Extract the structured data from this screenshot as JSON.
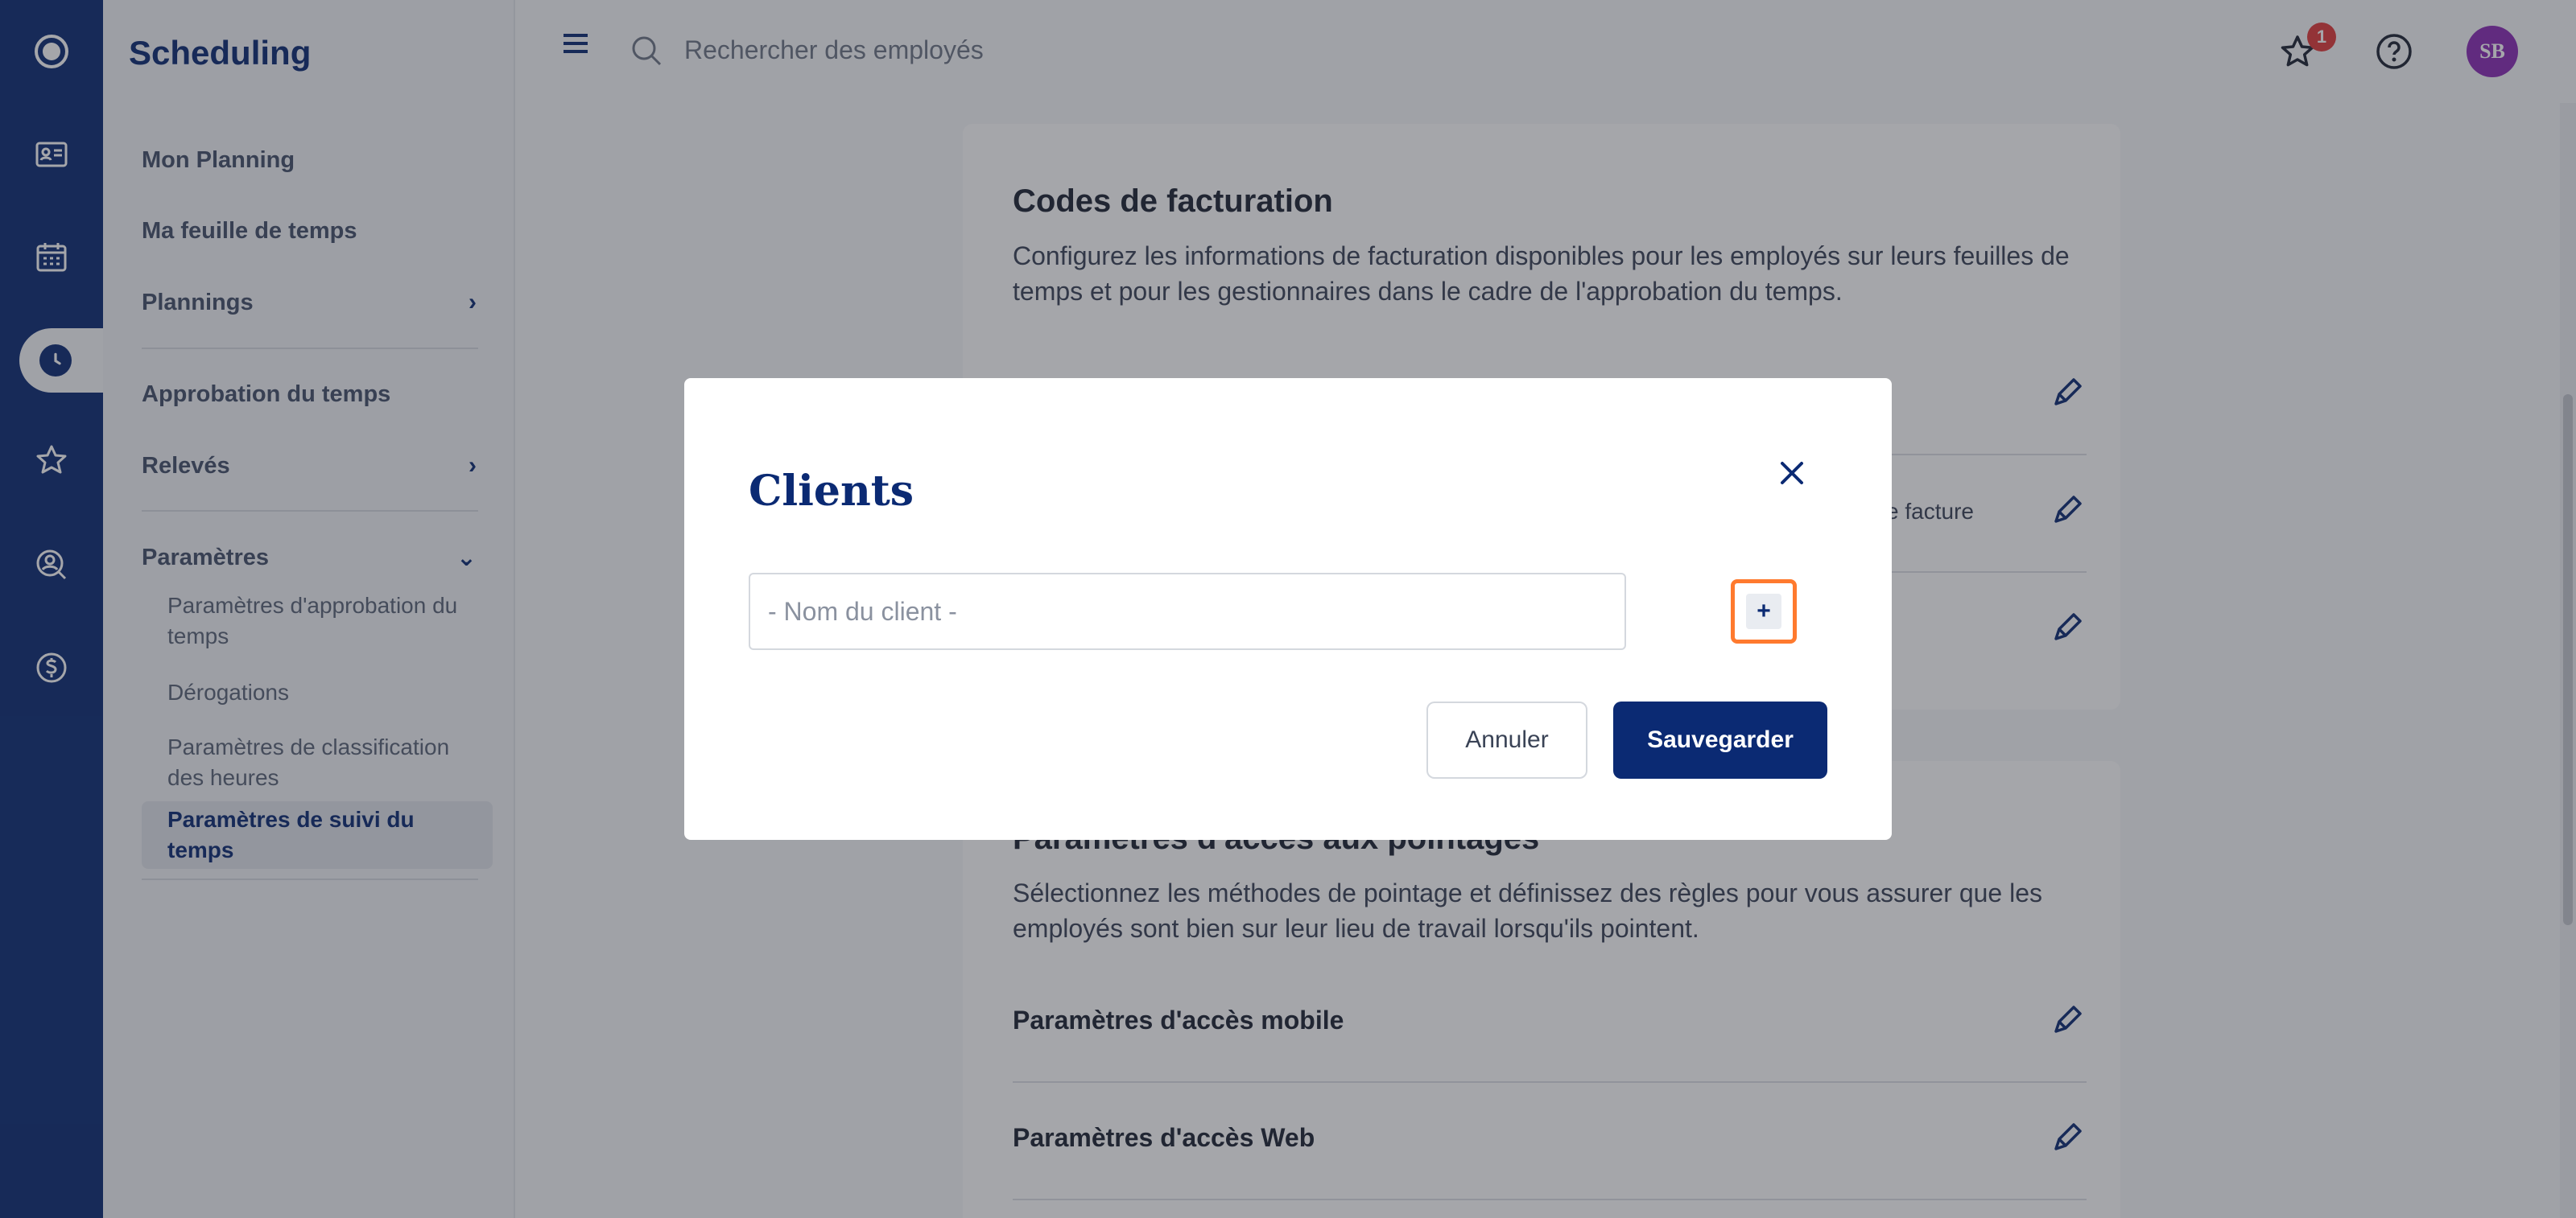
{
  "app": {
    "title": "Scheduling"
  },
  "rail": {
    "items": [
      {
        "icon": "logo-icon"
      },
      {
        "icon": "id-card-icon"
      },
      {
        "icon": "calendar-icon"
      },
      {
        "icon": "clock-icon",
        "active": true
      },
      {
        "icon": "star-icon"
      },
      {
        "icon": "user-search-icon"
      },
      {
        "icon": "dollar-icon"
      }
    ]
  },
  "sidebar": {
    "items": [
      {
        "label": "Mon Planning"
      },
      {
        "label": "Ma feuille de temps"
      },
      {
        "label": "Plannings",
        "chevron": "›"
      },
      {
        "label": "Approbation du temps"
      },
      {
        "label": "Relevés",
        "chevron": "›"
      },
      {
        "label": "Paramètres",
        "chevron": "⌄"
      }
    ],
    "sub_items": [
      {
        "label": "Paramètres d'approbation du temps"
      },
      {
        "label": "Dérogations"
      },
      {
        "label": "Paramètres de classification des heures"
      },
      {
        "label": "Paramètres de suivi du temps",
        "active": true
      }
    ]
  },
  "topbar": {
    "search_placeholder": "Rechercher des employés",
    "notification_count": "1",
    "avatar_initials": "SB"
  },
  "main": {
    "billing": {
      "title": "Codes de facturation",
      "description": "Configurez les informations de facturation disponibles pour les employés sur leurs feuilles de temps et pour les gestionnaires dans le cadre de l'approbation du temps.",
      "rows": [
        {
          "label": "",
          "tail": ""
        },
        {
          "label": "",
          "tail": "e facture"
        },
        {
          "label": "",
          "tail": ""
        }
      ]
    },
    "access": {
      "title": "Paramètres d'accès aux pointages",
      "description": "Sélectionnez les méthodes de pointage et définissez des règles pour vous assurer que les employés sont bien sur leur lieu de travail lorsqu'ils pointent.",
      "rows": [
        {
          "label": "Paramètres d'accès mobile"
        },
        {
          "label": "Paramètres d'accès Web"
        }
      ]
    }
  },
  "modal": {
    "title": "Clients",
    "input_placeholder": "- Nom du client -",
    "add_label": "+",
    "cancel_label": "Annuler",
    "save_label": "Sauvegarder"
  },
  "colors": {
    "brand": "#0b2a73",
    "highlight": "#ff7a2e",
    "badge": "#e03a3a",
    "avatar": "#8a2bb5"
  }
}
